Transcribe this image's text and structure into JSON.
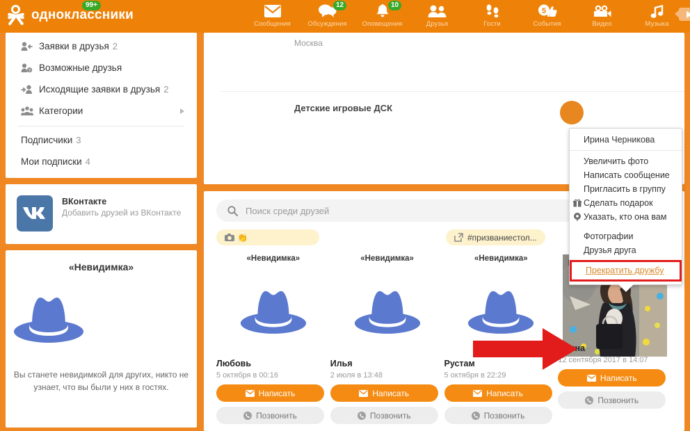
{
  "header": {
    "logo_text": "одноклассники",
    "logo_badge": "99+",
    "nav": [
      {
        "label": "Сообщения",
        "badge": "",
        "icon": "envelope-icon"
      },
      {
        "label": "Обсуждения",
        "badge": "12",
        "icon": "chat-bubbles-icon"
      },
      {
        "label": "Оповещения",
        "badge": "10",
        "icon": "bell-icon"
      },
      {
        "label": "Друзья",
        "badge": "",
        "icon": "people-icon"
      },
      {
        "label": "Гости",
        "badge": "",
        "icon": "footprints-icon"
      },
      {
        "label": "События",
        "badge": "",
        "icon": "thumbs-up-icon",
        "inline_count": "5"
      },
      {
        "label": "Видео",
        "badge": "",
        "icon": "video-camera-icon"
      },
      {
        "label": "Музыка",
        "badge": "",
        "icon": "music-note-icon"
      }
    ],
    "play_button": "play-icon"
  },
  "sidebar": {
    "menu": [
      {
        "label": "Заявки в друзья",
        "count": "2",
        "icon": "user-incoming-icon"
      },
      {
        "label": "Возможные друзья",
        "count": "",
        "icon": "user-question-icon"
      },
      {
        "label": "Исходящие заявки в друзья",
        "count": "2",
        "icon": "user-outgoing-icon"
      },
      {
        "label": "Категории",
        "count": "",
        "icon": "users-group-icon",
        "chevron": true
      }
    ],
    "secondary": [
      {
        "label": "Подписчики",
        "count": "3"
      },
      {
        "label": "Мои подписки",
        "count": "4"
      }
    ],
    "vk": {
      "logo_glyph": "VK",
      "title": "ВКонтакте",
      "subtitle": "Добавить друзей из ВКонтакте",
      "color": "#4a76a8"
    },
    "invisible": {
      "title": "«Невидимка»",
      "icon": "fedora-hat-icon",
      "note": "Вы станете невидимкой для других, никто не узнает, что вы были у них в гостях."
    }
  },
  "main": {
    "profile": {
      "city": "Москва",
      "group_title": "Детские игровые ДСК"
    },
    "search": {
      "placeholder": "Поиск среди друзей",
      "icon": "search-icon"
    },
    "tags": [
      {
        "label": "",
        "icon": "camera-icon",
        "emoji": "👏"
      },
      {
        "label": "#призваниестол...",
        "icon": "external-link-icon"
      }
    ],
    "friends": [
      {
        "invisible_label": "«Невидимка»",
        "avatar": "fedora-hat-icon",
        "name": "Любовь",
        "date": "5 октября в 00:16",
        "write_label": "Написать",
        "call_label": "Позвонить"
      },
      {
        "invisible_label": "«Невидимка»",
        "avatar": "fedora-hat-icon",
        "name": "Илья",
        "date": "2 июля в 13:48",
        "write_label": "Написать",
        "call_label": "Позвонить"
      },
      {
        "invisible_label": "«Невидимка»",
        "avatar": "fedora-hat-icon",
        "name": "Рустам",
        "date": "5 октября в 22:29",
        "write_label": "Написать",
        "call_label": "Позвонить"
      },
      {
        "invisible_label": "",
        "avatar": "photo-thumbnail",
        "name": "Ирина",
        "date": "12 сентября 2017 в 14:07",
        "write_label": "Написать",
        "call_label": "Позвонить"
      }
    ]
  },
  "dropdown": {
    "person_name": "Ирина Черникова",
    "items": [
      {
        "label": "Увеличить фото",
        "icon": ""
      },
      {
        "label": "Написать сообщение",
        "icon": ""
      },
      {
        "label": "Пригласить в группу",
        "icon": ""
      },
      {
        "label": "Сделать подарок",
        "icon": "gift-icon"
      },
      {
        "label": "Указать, кто она вам",
        "icon": "pin-icon"
      }
    ],
    "items2": [
      {
        "label": "Фотографии",
        "icon": ""
      },
      {
        "label": "Друзья друга",
        "icon": ""
      }
    ],
    "danger_label": "Прекратить дружбу",
    "highlight_color": "#e21b1b"
  },
  "annotation": {
    "arrow_color": "#e21b1b"
  },
  "theme": {
    "brand_orange": "#ee8208",
    "badge_green": "#3aa827",
    "hat_blue": "#5b79cf",
    "button_orange": "#f58b12"
  }
}
